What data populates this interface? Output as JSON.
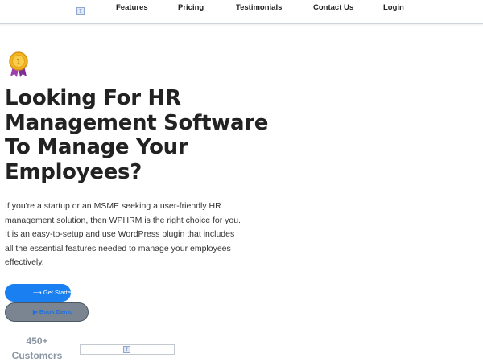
{
  "nav": {
    "logo_icon": "broken-image-icon",
    "items": [
      {
        "label": "Features"
      },
      {
        "label": "Pricing"
      },
      {
        "label": "Testimonials"
      },
      {
        "label": "Contact Us"
      },
      {
        "label": "Login"
      }
    ]
  },
  "hero": {
    "badge_icon": "gold-medal-icon",
    "badge_number": "1",
    "headline_lines": [
      "Looking For HR",
      "Management Software",
      "To Manage Your",
      "Employees?"
    ],
    "description_lines": [
      "If you're a startup or an MSME seeking a user-friendly HR",
      "management solution, then WPHRM is the right choice for you.",
      "It is an easy-to-setup and use WordPress plugin that includes",
      "all the essential features needed to manage your employees",
      "effectively."
    ],
    "primary_button": {
      "icon": "arrow-right-icon",
      "label": "Get Started"
    },
    "secondary_button": {
      "icon": "play-icon",
      "label": "Book Demo"
    }
  },
  "stats": {
    "number": "450+",
    "label": "Customers"
  },
  "colors": {
    "primary": "#1a7ff0",
    "secondary_bg": "#7a8591",
    "stat_text": "#8a96a3"
  }
}
